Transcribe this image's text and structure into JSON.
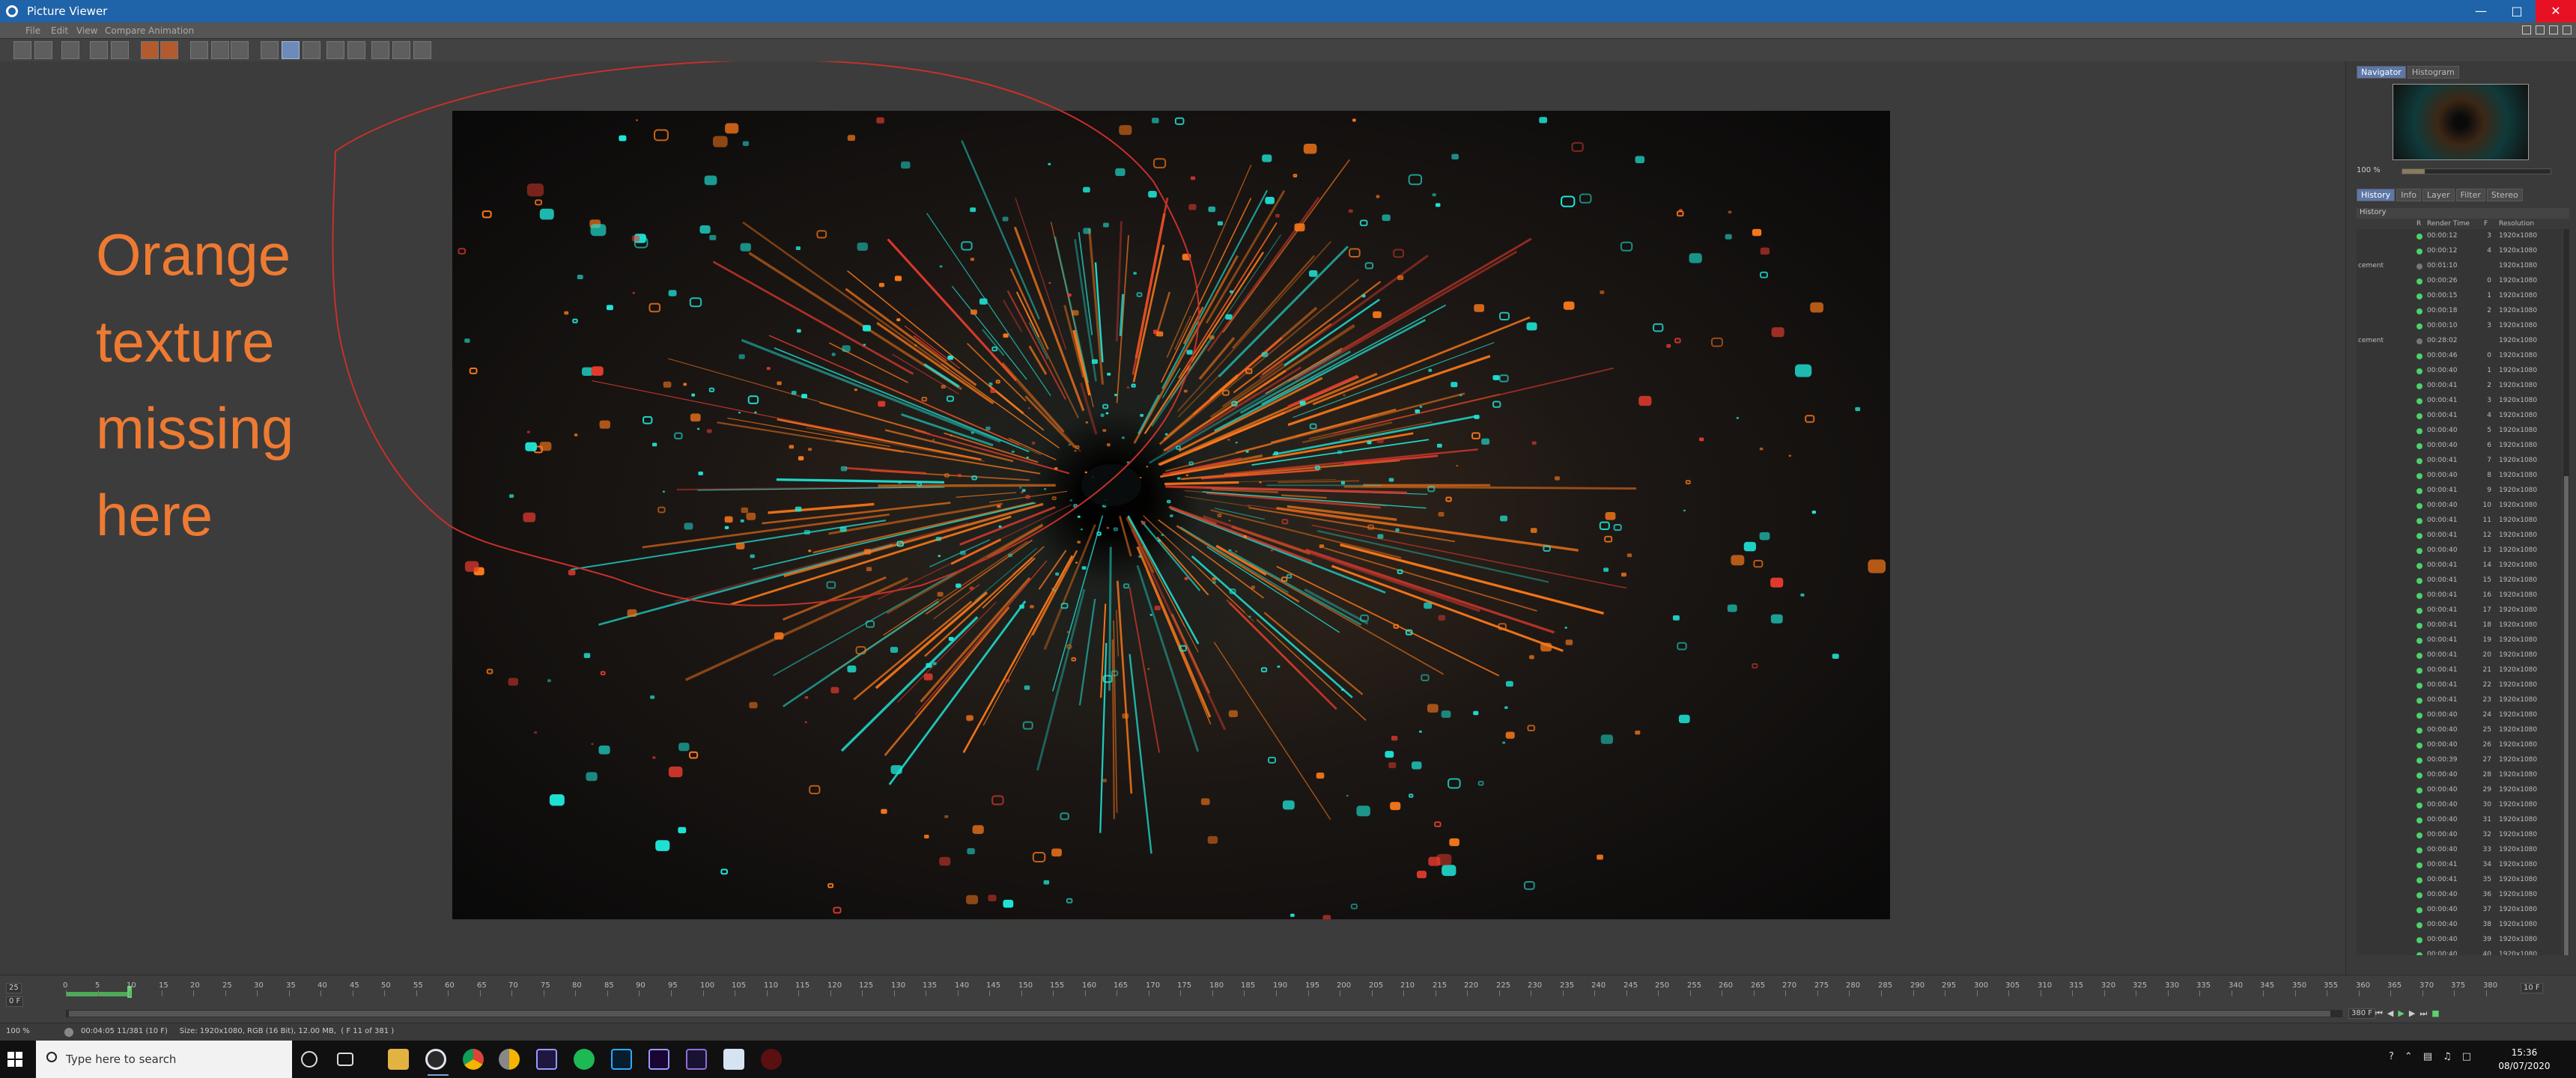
{
  "window": {
    "title": "Picture Viewer"
  },
  "menu": [
    "File",
    "Edit",
    "View",
    "Compare",
    "Animation"
  ],
  "annotation": {
    "lines": [
      "Orange",
      "texture",
      "missing",
      "here"
    ],
    "color": "#ee7a32"
  },
  "panel": {
    "top_tabs": [
      "Navigator",
      "Histogram"
    ],
    "zoom": "100 %",
    "zoom_level": 0.15,
    "tabs": [
      "History",
      "Info",
      "Layer",
      "Filter",
      "Stereo"
    ],
    "history_title": "History",
    "columns": [
      "R",
      "Render Time",
      "F",
      "Resolution"
    ],
    "rows": [
      {
        "name": "",
        "status": "green",
        "time": "00:00:12",
        "frame": "3",
        "res": "1920x1080"
      },
      {
        "name": "",
        "status": "green",
        "time": "00:00:12",
        "frame": "4",
        "res": "1920x1080"
      },
      {
        "name": "cement",
        "status": "grey",
        "time": "00:01:10",
        "frame": "",
        "res": "1920x1080"
      },
      {
        "name": "",
        "status": "green",
        "time": "00:00:26",
        "frame": "0",
        "res": "1920x1080"
      },
      {
        "name": "",
        "status": "green",
        "time": "00:00:15",
        "frame": "1",
        "res": "1920x1080"
      },
      {
        "name": "",
        "status": "green",
        "time": "00:00:18",
        "frame": "2",
        "res": "1920x1080"
      },
      {
        "name": "",
        "status": "green",
        "time": "00:00:10",
        "frame": "3",
        "res": "1920x1080"
      },
      {
        "name": "cement",
        "status": "grey",
        "time": "00:28:02",
        "frame": "",
        "res": "1920x1080"
      },
      {
        "name": "",
        "status": "green",
        "time": "00:00:46",
        "frame": "0",
        "res": "1920x1080"
      },
      {
        "name": "",
        "status": "green",
        "time": "00:00:40",
        "frame": "1",
        "res": "1920x1080"
      },
      {
        "name": "",
        "status": "green",
        "time": "00:00:41",
        "frame": "2",
        "res": "1920x1080"
      },
      {
        "name": "",
        "status": "green",
        "time": "00:00:41",
        "frame": "3",
        "res": "1920x1080"
      },
      {
        "name": "",
        "status": "green",
        "time": "00:00:41",
        "frame": "4",
        "res": "1920x1080"
      },
      {
        "name": "",
        "status": "green",
        "time": "00:00:40",
        "frame": "5",
        "res": "1920x1080"
      },
      {
        "name": "",
        "status": "green",
        "time": "00:00:40",
        "frame": "6",
        "res": "1920x1080"
      },
      {
        "name": "",
        "status": "green",
        "time": "00:00:41",
        "frame": "7",
        "res": "1920x1080"
      },
      {
        "name": "",
        "status": "green",
        "time": "00:00:40",
        "frame": "8",
        "res": "1920x1080"
      },
      {
        "name": "",
        "status": "green",
        "time": "00:00:41",
        "frame": "9",
        "res": "1920x1080"
      },
      {
        "name": "",
        "status": "green",
        "time": "00:00:40",
        "frame": "10",
        "res": "1920x1080"
      },
      {
        "name": "",
        "status": "green",
        "time": "00:00:41",
        "frame": "11",
        "res": "1920x1080"
      },
      {
        "name": "",
        "status": "green",
        "time": "00:00:41",
        "frame": "12",
        "res": "1920x1080"
      },
      {
        "name": "",
        "status": "green",
        "time": "00:00:40",
        "frame": "13",
        "res": "1920x1080"
      },
      {
        "name": "",
        "status": "green",
        "time": "00:00:41",
        "frame": "14",
        "res": "1920x1080"
      },
      {
        "name": "",
        "status": "green",
        "time": "00:00:41",
        "frame": "15",
        "res": "1920x1080"
      },
      {
        "name": "",
        "status": "green",
        "time": "00:00:41",
        "frame": "16",
        "res": "1920x1080"
      },
      {
        "name": "",
        "status": "green",
        "time": "00:00:41",
        "frame": "17",
        "res": "1920x1080"
      },
      {
        "name": "",
        "status": "green",
        "time": "00:00:41",
        "frame": "18",
        "res": "1920x1080"
      },
      {
        "name": "",
        "status": "green",
        "time": "00:00:41",
        "frame": "19",
        "res": "1920x1080"
      },
      {
        "name": "",
        "status": "green",
        "time": "00:00:41",
        "frame": "20",
        "res": "1920x1080"
      },
      {
        "name": "",
        "status": "green",
        "time": "00:00:41",
        "frame": "21",
        "res": "1920x1080"
      },
      {
        "name": "",
        "status": "green",
        "time": "00:00:41",
        "frame": "22",
        "res": "1920x1080"
      },
      {
        "name": "",
        "status": "green",
        "time": "00:00:41",
        "frame": "23",
        "res": "1920x1080"
      },
      {
        "name": "",
        "status": "green",
        "time": "00:00:40",
        "frame": "24",
        "res": "1920x1080"
      },
      {
        "name": "",
        "status": "green",
        "time": "00:00:40",
        "frame": "25",
        "res": "1920x1080"
      },
      {
        "name": "",
        "status": "green",
        "time": "00:00:40",
        "frame": "26",
        "res": "1920x1080"
      },
      {
        "name": "",
        "status": "green",
        "time": "00:00:39",
        "frame": "27",
        "res": "1920x1080"
      },
      {
        "name": "",
        "status": "green",
        "time": "00:00:40",
        "frame": "28",
        "res": "1920x1080"
      },
      {
        "name": "",
        "status": "green",
        "time": "00:00:40",
        "frame": "29",
        "res": "1920x1080"
      },
      {
        "name": "",
        "status": "green",
        "time": "00:00:40",
        "frame": "30",
        "res": "1920x1080"
      },
      {
        "name": "",
        "status": "green",
        "time": "00:00:40",
        "frame": "31",
        "res": "1920x1080"
      },
      {
        "name": "",
        "status": "green",
        "time": "00:00:40",
        "frame": "32",
        "res": "1920x1080"
      },
      {
        "name": "",
        "status": "green",
        "time": "00:00:40",
        "frame": "33",
        "res": "1920x1080"
      },
      {
        "name": "",
        "status": "green",
        "time": "00:00:41",
        "frame": "34",
        "res": "1920x1080"
      },
      {
        "name": "",
        "status": "green",
        "time": "00:00:41",
        "frame": "35",
        "res": "1920x1080"
      },
      {
        "name": "",
        "status": "green",
        "time": "00:00:40",
        "frame": "36",
        "res": "1920x1080"
      },
      {
        "name": "",
        "status": "green",
        "time": "00:00:40",
        "frame": "37",
        "res": "1920x1080"
      },
      {
        "name": "",
        "status": "green",
        "time": "00:00:40",
        "frame": "38",
        "res": "1920x1080"
      },
      {
        "name": "",
        "status": "green",
        "time": "00:00:40",
        "frame": "39",
        "res": "1920x1080"
      },
      {
        "name": "",
        "status": "green",
        "time": "00:00:40",
        "frame": "40",
        "res": "1920x1080"
      }
    ]
  },
  "timeline": {
    "fps": "25",
    "start": "0 F",
    "end": "380 F",
    "end_right": "10 F",
    "ruler_max": 380,
    "ruler_step": 5,
    "current_frame": 10,
    "progress_frames": 10
  },
  "status": {
    "zoom": "100 %",
    "text": "00:04:05 11/381 (10 F)     Size: 1920x1080, RGB (16 Bit), 12.00 MB,  ( F 11 of 381 )"
  },
  "taskbar": {
    "search_placeholder": "Type here to search",
    "time": "15:36",
    "date": "08/07/2020",
    "apps": [
      "task-view-icon",
      "file-explorer-icon",
      "cinema4d-icon",
      "chrome-icon",
      "chrome-canary-icon",
      "after-effects-icon",
      "spotify-icon",
      "photoshop-icon",
      "premiere-icon",
      "media-encoder-icon",
      "notepad-icon",
      "redshift-icon"
    ]
  },
  "colors": {
    "titlebar": "#1f63a8",
    "teal": "#1fe6d8",
    "orange": "#ff7a1a",
    "red": "#e23b2e",
    "status_green": "#4ed06a"
  }
}
